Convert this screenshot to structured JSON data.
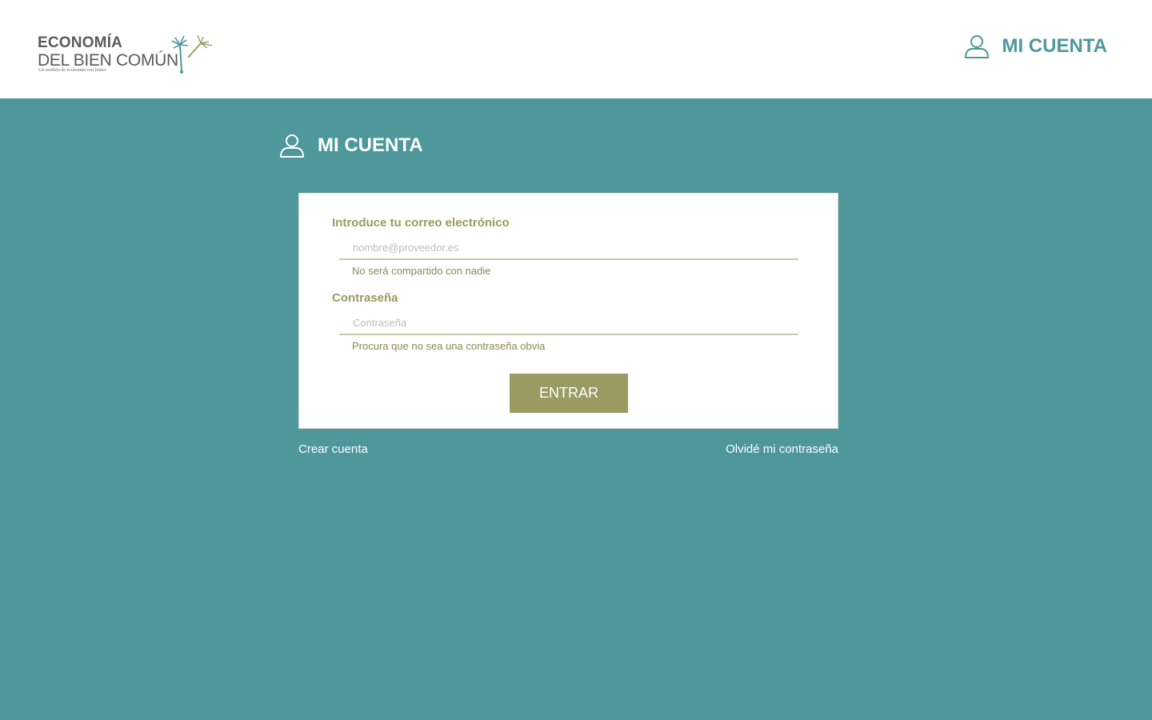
{
  "header": {
    "logo": {
      "line1": "ECONOMÍA",
      "line2": "DEL BIEN COMÚN",
      "tagline": "Un modelo de economía con futuro",
      "icon": "palm-plant-logo-icon"
    },
    "account_label": "MI CUENTA",
    "account_icon": "user-icon"
  },
  "page": {
    "title": "MI CUENTA",
    "title_icon": "user-icon"
  },
  "login_form": {
    "email": {
      "label": "Introduce tu correo electrónico",
      "placeholder": "nombre@proveedor.es",
      "value": "",
      "help": "No será compartido con nadie"
    },
    "password": {
      "label": "Contraseña",
      "placeholder": "Contraseña",
      "value": "",
      "help": "Procura que no sea una contraseña obvia"
    },
    "submit_label": "ENTRAR"
  },
  "links": {
    "create_account": "Crear cuenta",
    "forgot_password": "Olvidé mi contraseña"
  },
  "colors": {
    "teal": "#4e979a",
    "olive": "#9a9a62",
    "logo_gray": "#5a5a5a",
    "white": "#ffffff"
  }
}
